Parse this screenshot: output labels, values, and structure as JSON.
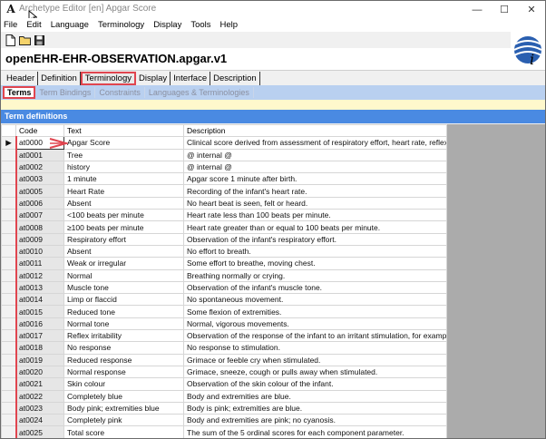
{
  "window": {
    "title": "Archetype Editor [en] Apgar Score",
    "minimize": "—",
    "maximize": "☐",
    "close": "✕"
  },
  "menu": [
    "File",
    "Edit",
    "Language",
    "Terminology",
    "Display",
    "Tools",
    "Help"
  ],
  "toolbar": {
    "icons": [
      "new-icon",
      "open-folder-icon",
      "save-disk-icon"
    ]
  },
  "archetype": {
    "id": "openEHR-EHR-OBSERVATION.apgar.v1",
    "logo": "openEHR-logo-icon"
  },
  "main_tabs": [
    {
      "label": "Header",
      "active": false
    },
    {
      "label": "Definition",
      "active": false
    },
    {
      "label": "Terminology",
      "active": true
    },
    {
      "label": "Display",
      "active": false
    },
    {
      "label": "Interface",
      "active": false
    },
    {
      "label": "Description",
      "active": false
    }
  ],
  "sub_tabs": [
    {
      "label": "Terms",
      "active": true
    },
    {
      "label": "Term Bindings",
      "active": false
    },
    {
      "label": "Constraints",
      "active": false
    },
    {
      "label": "Languages & Terminologies",
      "active": false
    }
  ],
  "section_title": "Term definitions",
  "table": {
    "columns": [
      "Code",
      "Text",
      "Description"
    ],
    "current_row_marker": "▶",
    "rows": [
      {
        "code": "at0000",
        "text": "Apgar Score",
        "description": "Clinical score derived from assessment of respiratory effort, heart rate, reflex irrita"
      },
      {
        "code": "at0001",
        "text": "Tree",
        "description": "@ internal @"
      },
      {
        "code": "at0002",
        "text": "history",
        "description": "@ internal @"
      },
      {
        "code": "at0003",
        "text": "1 minute",
        "description": "Apgar score 1 minute after birth."
      },
      {
        "code": "at0005",
        "text": "Heart Rate",
        "description": "Recording of the infant's heart rate."
      },
      {
        "code": "at0006",
        "text": "Absent",
        "description": "No heart beat is seen, felt or heard."
      },
      {
        "code": "at0007",
        "text": "<100 beats per minute",
        "description": "Heart rate less than 100 beats per minute."
      },
      {
        "code": "at0008",
        "text": "≥100 beats per minute",
        "description": "Heart rate greater than or equal to 100 beats per minute."
      },
      {
        "code": "at0009",
        "text": "Respiratory effort",
        "description": "Observation of the infant's respiratory effort."
      },
      {
        "code": "at0010",
        "text": "Absent",
        "description": "No effort to breath."
      },
      {
        "code": "at0011",
        "text": "Weak or irregular",
        "description": "Some effort to breathe, moving chest."
      },
      {
        "code": "at0012",
        "text": "Normal",
        "description": "Breathing normally or crying."
      },
      {
        "code": "at0013",
        "text": "Muscle tone",
        "description": "Observation of the infant's muscle tone."
      },
      {
        "code": "at0014",
        "text": "Limp or flaccid",
        "description": "No spontaneous movement."
      },
      {
        "code": "at0015",
        "text": "Reduced tone",
        "description": "Some flexion of extremities."
      },
      {
        "code": "at0016",
        "text": "Normal tone",
        "description": "Normal, vigorous movements."
      },
      {
        "code": "at0017",
        "text": "Reflex irritability",
        "description": "Observation of the response of the infant to an irritant stimulation, for example, s"
      },
      {
        "code": "at0018",
        "text": "No response",
        "description": "No response to stimulation."
      },
      {
        "code": "at0019",
        "text": "Reduced response",
        "description": "Grimace or feeble cry when stimulated."
      },
      {
        "code": "at0020",
        "text": "Normal response",
        "description": "Grimace, sneeze, cough or pulls away when stimulated."
      },
      {
        "code": "at0021",
        "text": "Skin colour",
        "description": "Observation of the skin colour of the infant."
      },
      {
        "code": "at0022",
        "text": "Completely blue",
        "description": "Body and extremities are blue."
      },
      {
        "code": "at0023",
        "text": "Body pink; extremities blue",
        "description": "Body is pink; extremities are blue."
      },
      {
        "code": "at0024",
        "text": "Completely pink",
        "description": "Body and extremities are pink; no cyanosis."
      },
      {
        "code": "at0025",
        "text": "Total score",
        "description": "The sum of the 5 ordinal scores for each component parameter."
      }
    ]
  },
  "colors": {
    "highlight": "#e0454f",
    "section_header": "#4a8ae2",
    "sub_tab_bar": "#b9d0f0"
  }
}
